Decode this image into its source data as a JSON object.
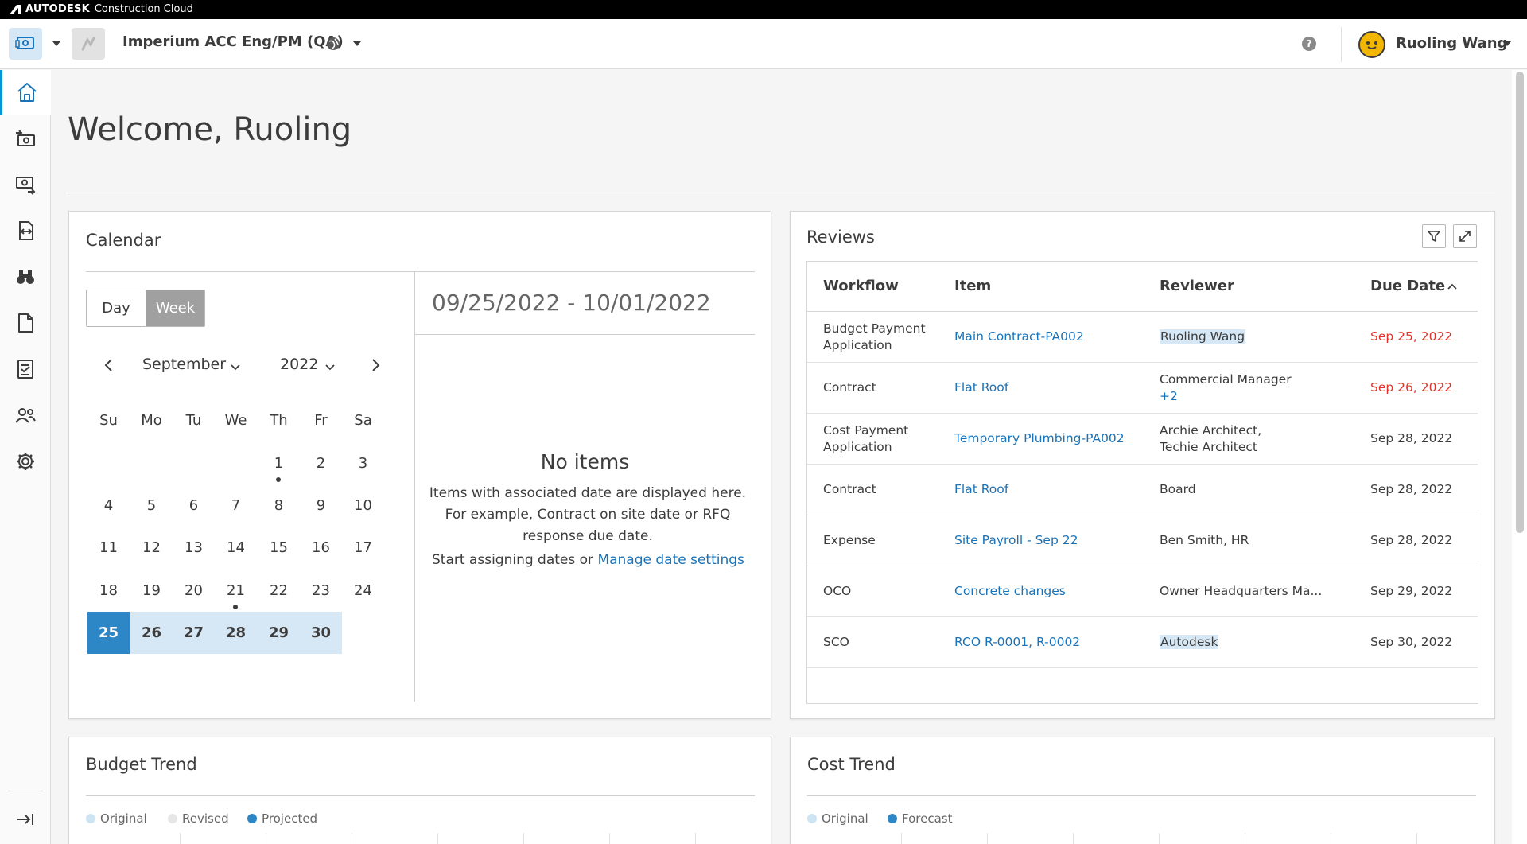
{
  "brand": {
    "name": "AUTODESK",
    "product": "Construction Cloud"
  },
  "header": {
    "project_name": "Imperium ACC Eng/PM (QA)",
    "help_label": "?",
    "user_name": "Ruoling Wang"
  },
  "sidebar": {
    "items": [
      {
        "name": "home",
        "icon": "home-icon",
        "active": true
      },
      {
        "name": "module-2",
        "icon": "money-in-icon"
      },
      {
        "name": "module-3",
        "icon": "money-out-icon"
      },
      {
        "name": "module-4",
        "icon": "exchange-icon"
      },
      {
        "name": "module-5",
        "icon": "binoculars-icon"
      },
      {
        "name": "module-6",
        "icon": "document-icon"
      },
      {
        "name": "module-7",
        "icon": "report-icon"
      },
      {
        "name": "module-8",
        "icon": "members-icon"
      },
      {
        "name": "module-9",
        "icon": "settings-icon"
      }
    ],
    "collapse_icon": "collapse-icon"
  },
  "main": {
    "welcome": "Welcome, Ruoling"
  },
  "calendar": {
    "title": "Calendar",
    "view_day": "Day",
    "view_week": "Week",
    "month": "September",
    "year": "2022",
    "weekdays": [
      "Su",
      "Mo",
      "Tu",
      "We",
      "Th",
      "Fr",
      "Sa"
    ],
    "weeks": [
      [
        "",
        "",
        "",
        "",
        "1",
        "2",
        "3"
      ],
      [
        "4",
        "5",
        "6",
        "7",
        "8",
        "9",
        "10"
      ],
      [
        "11",
        "12",
        "13",
        "14",
        "15",
        "16",
        "17"
      ],
      [
        "18",
        "19",
        "20",
        "21",
        "22",
        "23",
        "24"
      ],
      [
        "25",
        "26",
        "27",
        "28",
        "29",
        "30",
        ""
      ]
    ],
    "selected_day": "25",
    "range": "09/25/2022 - 10/01/2022",
    "no_items_title": "No items",
    "no_items_desc": "Items with associated date are displayed here. For example, Contract on site date or RFQ response due date.",
    "assign_text": "Start assigning dates or ",
    "assign_link": "Manage date settings"
  },
  "reviews": {
    "title": "Reviews",
    "columns": [
      "Workflow",
      "Item",
      "Reviewer",
      "Due Date"
    ],
    "rows": [
      {
        "workflow": [
          "Budget Payment",
          "Application"
        ],
        "item": "Main Contract-PA002",
        "reviewer": [
          "Ruoling Wang"
        ],
        "reviewer_hl": true,
        "due": "Sep 25, 2022",
        "overdue": true
      },
      {
        "workflow": [
          "Contract"
        ],
        "item": "Flat Roof",
        "reviewer": [
          "Commercial Manager",
          "+2"
        ],
        "reviewer_hl": false,
        "due": "Sep 26, 2022",
        "overdue": true
      },
      {
        "workflow": [
          "Cost Payment",
          "Application"
        ],
        "item": "Temporary Plumbing-PA002",
        "reviewer": [
          "Archie Architect,",
          "Techie Architect"
        ],
        "reviewer_hl": false,
        "due": "Sep 28, 2022",
        "overdue": false
      },
      {
        "workflow": [
          "Contract"
        ],
        "item": "Flat Roof",
        "reviewer": [
          "Board"
        ],
        "reviewer_hl": false,
        "due": "Sep 28, 2022",
        "overdue": false
      },
      {
        "workflow": [
          "Expense"
        ],
        "item": "Site Payroll - Sep 22",
        "reviewer": [
          "Ben Smith, HR"
        ],
        "reviewer_hl": false,
        "due": "Sep 28, 2022",
        "overdue": false
      },
      {
        "workflow": [
          "OCO"
        ],
        "item": "Concrete changes",
        "reviewer": [
          "Owner Headquarters Ma..."
        ],
        "reviewer_hl": false,
        "due": "Sep 29, 2022",
        "overdue": false
      },
      {
        "workflow": [
          "SCO"
        ],
        "item": "RCO R-0001, R-0002",
        "reviewer": [
          "Autodesk"
        ],
        "reviewer_hl": true,
        "due": "Sep 30, 2022",
        "overdue": false
      }
    ]
  },
  "budget_trend": {
    "title": "Budget Trend",
    "legend": [
      {
        "label": "Original",
        "color": "#cde4f2"
      },
      {
        "label": "Revised",
        "color": "#e6e6e6"
      },
      {
        "label": "Projected",
        "color": "#2d87c7"
      }
    ]
  },
  "cost_trend": {
    "title": "Cost Trend",
    "legend": [
      {
        "label": "Original",
        "color": "#cde4f2"
      },
      {
        "label": "Forecast",
        "color": "#2d87c7"
      }
    ]
  },
  "colors": {
    "accent": "#0696d7",
    "link": "#1a73b8",
    "overdue": "#e2332a",
    "selected": "#2d87c7",
    "week_highlight": "#d6e8f5"
  }
}
